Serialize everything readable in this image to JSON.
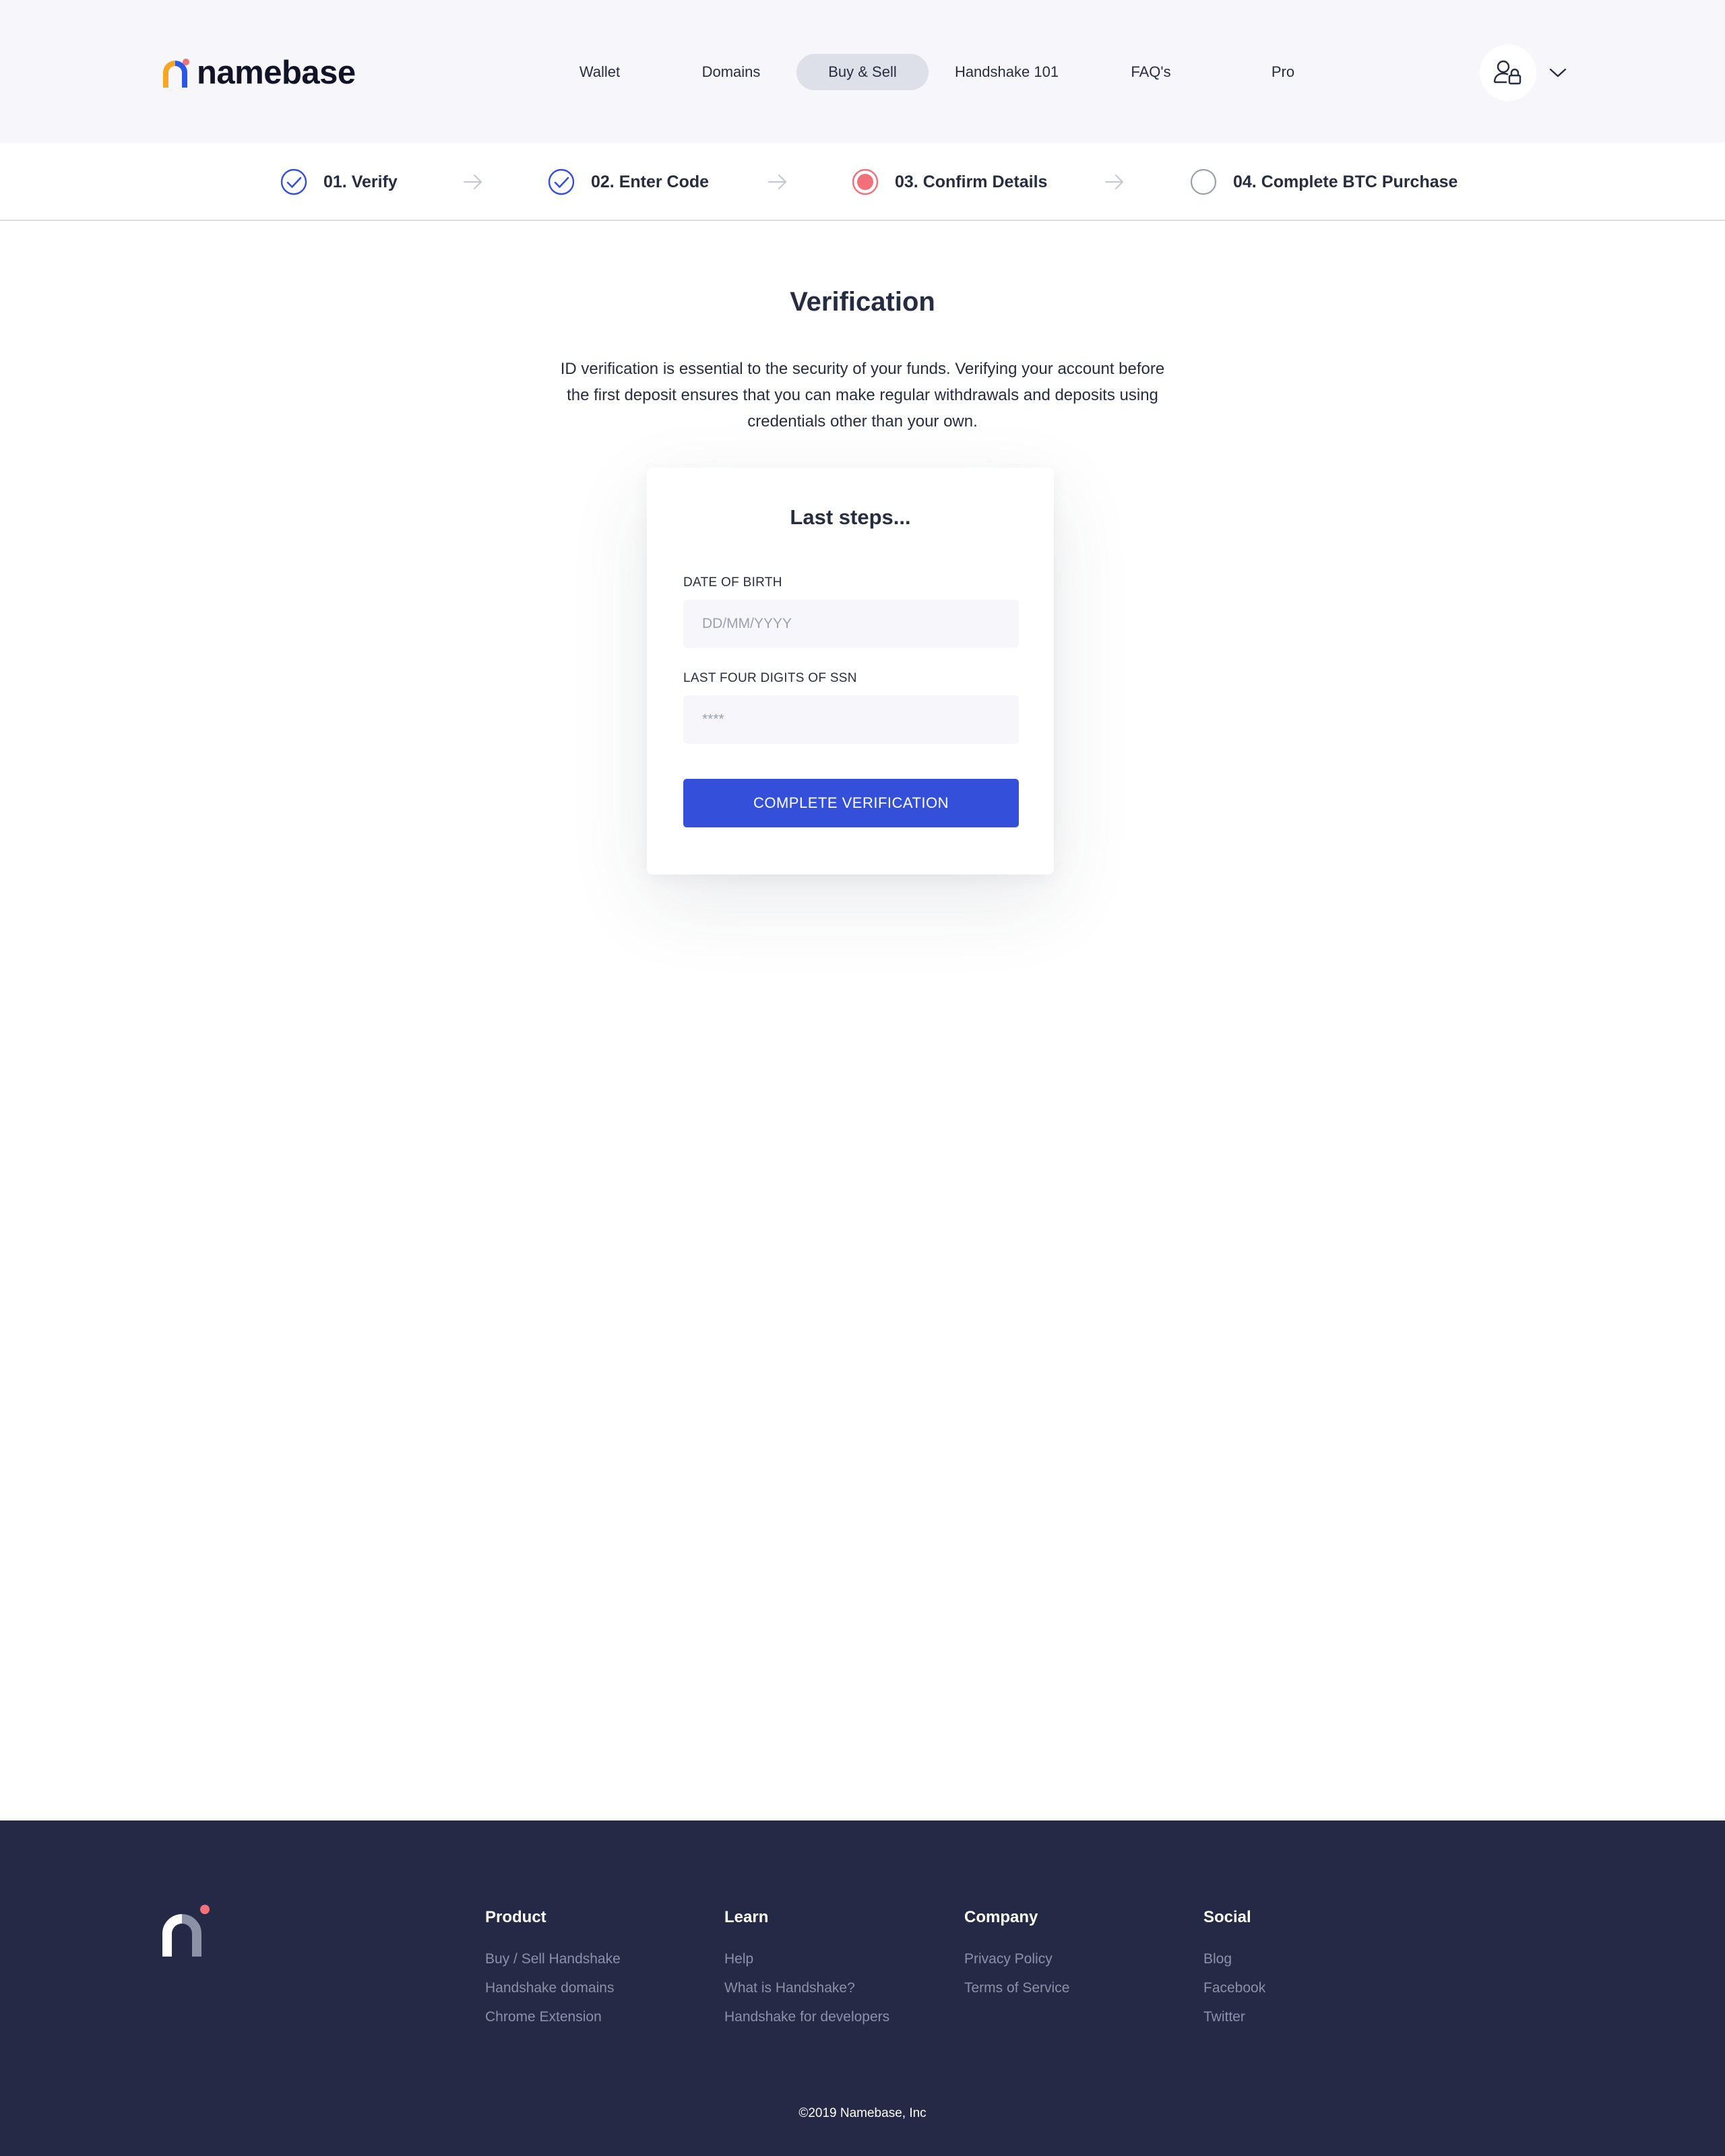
{
  "header": {
    "logo_text": "namebase",
    "nav": [
      {
        "label": "Wallet",
        "active": false
      },
      {
        "label": "Domains",
        "active": false
      },
      {
        "label": "Buy & Sell",
        "active": true
      },
      {
        "label": "Handshake 101",
        "active": false
      },
      {
        "label": "FAQ's",
        "active": false
      },
      {
        "label": "Pro",
        "active": false
      }
    ],
    "account_icon": "user-lock-icon",
    "menu_icon": "chevron-down-icon"
  },
  "steps": [
    {
      "label": "01. Verify",
      "status": "completed",
      "icon": "check-circle-icon"
    },
    {
      "label": "02. Enter Code",
      "status": "completed",
      "icon": "check-circle-icon"
    },
    {
      "label": "03. Confirm Details",
      "status": "current",
      "icon": "current-step-icon"
    },
    {
      "label": "04. Complete BTC Purchase",
      "status": "pending",
      "icon": "empty-circle-icon"
    }
  ],
  "main": {
    "title": "Verification",
    "intro": "ID verification is essential to the security of your funds. Verifying your account before the first deposit ensures that you can make regular withdrawals and deposits using credentials other than your own.",
    "card": {
      "title": "Last steps...",
      "dob_label": "DATE OF BIRTH",
      "dob_value": "",
      "dob_placeholder": "DD/MM/YYYY",
      "ssn_label": "LAST FOUR DIGITS OF SSN",
      "ssn_value": "",
      "ssn_placeholder": "****",
      "submit_label": "COMPLETE VERIFICATION"
    }
  },
  "footer": {
    "columns": [
      {
        "title": "Product",
        "links": [
          "Buy / Sell Handshake",
          "Handshake domains",
          "Chrome Extension"
        ]
      },
      {
        "title": "Learn",
        "links": [
          "Help",
          "What is Handshake?",
          "Handshake for developers"
        ]
      },
      {
        "title": "Company",
        "links": [
          "Privacy Policy",
          "Terms of Service"
        ]
      },
      {
        "title": "Social",
        "links": [
          "Blog",
          "Facebook",
          "Twitter"
        ]
      }
    ],
    "copyright": "©2019 Namebase, Inc"
  },
  "colors": {
    "brand_blue": "#3450db",
    "accent_red": "#f2707a",
    "logo_orange": "#f6a623",
    "logo_blue": "#2b57e6",
    "footer_bg": "#242a45",
    "header_bg": "#f7f7fb"
  }
}
